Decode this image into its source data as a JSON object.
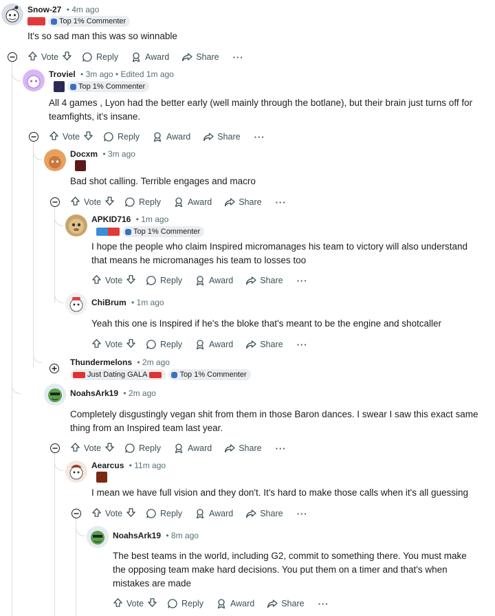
{
  "labels": {
    "vote": "Vote",
    "reply": "Reply",
    "award": "Award",
    "share": "Share",
    "more": "···"
  },
  "comments": [
    {
      "user": "Snow-27",
      "meta": "• 4m ago",
      "flair_text": "Top 1% Commenter",
      "body": "It's so sad man this was so winnable"
    },
    {
      "user": "Troviel",
      "meta": "• 3m ago • Edited 1m ago",
      "flair_text": "Top 1% Commenter",
      "body_lines": [
        "All 4 games , Lyon had the better early (well mainly through the botlane), but their brain just turns off for",
        "teamfights, it's insane."
      ]
    },
    {
      "user": "Docxm",
      "meta": "• 3m ago",
      "body": "Bad shot calling. Terrible engages and macro"
    },
    {
      "user": "APKID716",
      "meta": "• 1m ago",
      "flair_text": "Top 1% Commenter",
      "body_lines": [
        "I hope the people who claim Inspired micromanages his team to victory will also understand",
        "that means he micromanages his team to losses too"
      ]
    },
    {
      "user": "ChiBrum",
      "meta": "• 1m ago",
      "body": "Yeah this one is Inspired if he's the bloke that's meant to be the engine and shotcaller"
    },
    {
      "user": "Thundermelons",
      "meta": "• 2m ago",
      "flair_text": "Just Dating GALA",
      "flair_text_2": "Top 1% Commenter"
    },
    {
      "user": "NoahsArk19",
      "meta": "• 2m ago",
      "body_lines": [
        "Completely disgustingly vegan shit from them in those Baron dances. I swear I saw this exact same",
        "thing from an Inspired team last year."
      ]
    },
    {
      "user": "Aearcus",
      "meta": "• 11m ago",
      "body": "I mean we have full vision and they don't. It's hard to make those calls when it's all guessing"
    },
    {
      "user": "NoahsArk19",
      "meta": "• 8m ago",
      "body_lines": [
        "The best teams in the world, including G2, commit to something there. You must make",
        "the opposing team make hard decisions. You put them on a timer and that's when",
        "mistakes are made"
      ]
    }
  ],
  "colors": {
    "text": "#1c1c1c",
    "meta": "#576f76",
    "chip_bg": "#eaedef",
    "thread_line": "#dcdcdc"
  }
}
